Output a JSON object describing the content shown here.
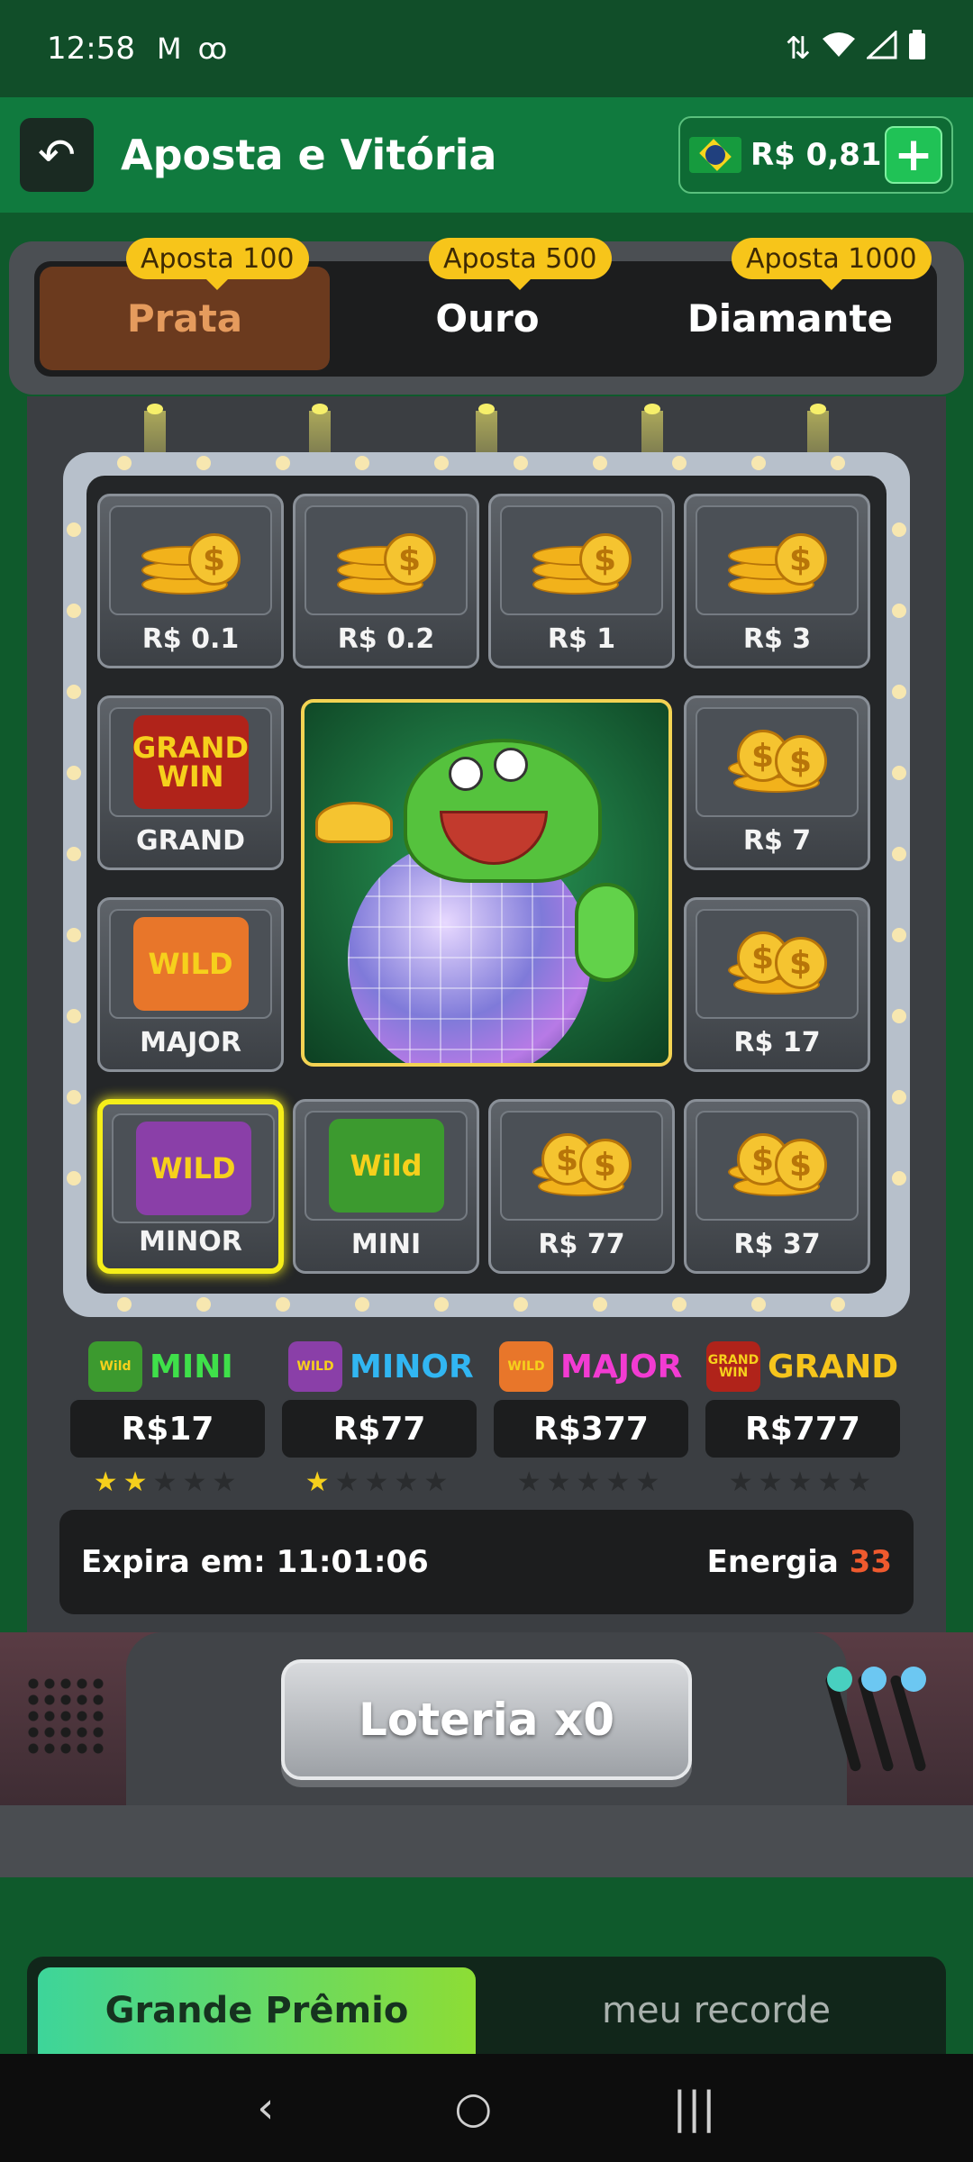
{
  "status": {
    "time": "12:58",
    "left_icons": [
      "gmail-icon",
      "voicemail-icon"
    ],
    "right_icons": [
      "data-arrows-icon",
      "wifi-icon",
      "signal-icon",
      "battery-icon"
    ]
  },
  "header": {
    "title": "Aposta e Vitória",
    "balance": "R$ 0,81"
  },
  "tabs": [
    {
      "badge": "Aposta 100",
      "label": "Prata",
      "active": true
    },
    {
      "badge": "Aposta 500",
      "label": "Ouro",
      "active": false
    },
    {
      "badge": "Aposta 1000",
      "label": "Diamante",
      "active": false
    }
  ],
  "cells": [
    {
      "label": "R$ 0.1",
      "icon": "coin-stack-icon"
    },
    {
      "label": "R$ 0.2",
      "icon": "coin-stack-icon"
    },
    {
      "label": "R$ 1",
      "icon": "coin-stack-icon"
    },
    {
      "label": "R$ 3",
      "icon": "coin-stack-icon"
    },
    {
      "label": "GRAND",
      "icon": "grand-win-icon",
      "icon_text": "GRAND WIN"
    },
    {
      "label": "R$ 7",
      "icon": "coin-pile-icon"
    },
    {
      "label": "MAJOR",
      "icon": "tiger-wild-icon",
      "icon_text": "WILD"
    },
    {
      "label": "R$ 17",
      "icon": "coin-pile-icon"
    },
    {
      "label": "MINOR",
      "icon": "rabbit-wild-icon",
      "icon_text": "WILD",
      "highlighted": true
    },
    {
      "label": "MINI",
      "icon": "dragon-wild-icon",
      "icon_text": "Wild"
    },
    {
      "label": "R$ 77",
      "icon": "coin-pile-icon"
    },
    {
      "label": "R$ 37",
      "icon": "coin-pile-icon"
    }
  ],
  "jackpots": [
    {
      "name": "MINI",
      "value": "R$17",
      "icon_text": "Wild",
      "name_color": "#3fe04a",
      "stars": 2,
      "max_stars": 5
    },
    {
      "name": "MINOR",
      "value": "R$77",
      "icon_text": "WILD",
      "name_color": "#31b6f2",
      "stars": 1,
      "max_stars": 5
    },
    {
      "name": "MAJOR",
      "value": "R$377",
      "icon_text": "WILD",
      "name_color": "#f23bd2",
      "stars": 0,
      "max_stars": 5
    },
    {
      "name": "GRAND",
      "value": "R$777",
      "icon_text": "GRAND WIN",
      "name_color": "#f6c51c",
      "stars": 0,
      "max_stars": 5
    }
  ],
  "info": {
    "expira_label": "Expira em: 11:01:06",
    "energia_label": "Energia",
    "energia_value": "33"
  },
  "lottery_button": "Loteria x0",
  "bottom_tabs": {
    "active": "Grande Prêmio",
    "inactive": "meu recorde"
  },
  "nav": {
    "back": "‹",
    "home": "○",
    "recents": "|||"
  },
  "colors": {
    "header_green": "#107a3e",
    "active_tab_text": "#e59b5d",
    "badge_yellow": "#f7c51a",
    "energy_value": "#ef5a2e",
    "highlight": "#f5ee19"
  }
}
